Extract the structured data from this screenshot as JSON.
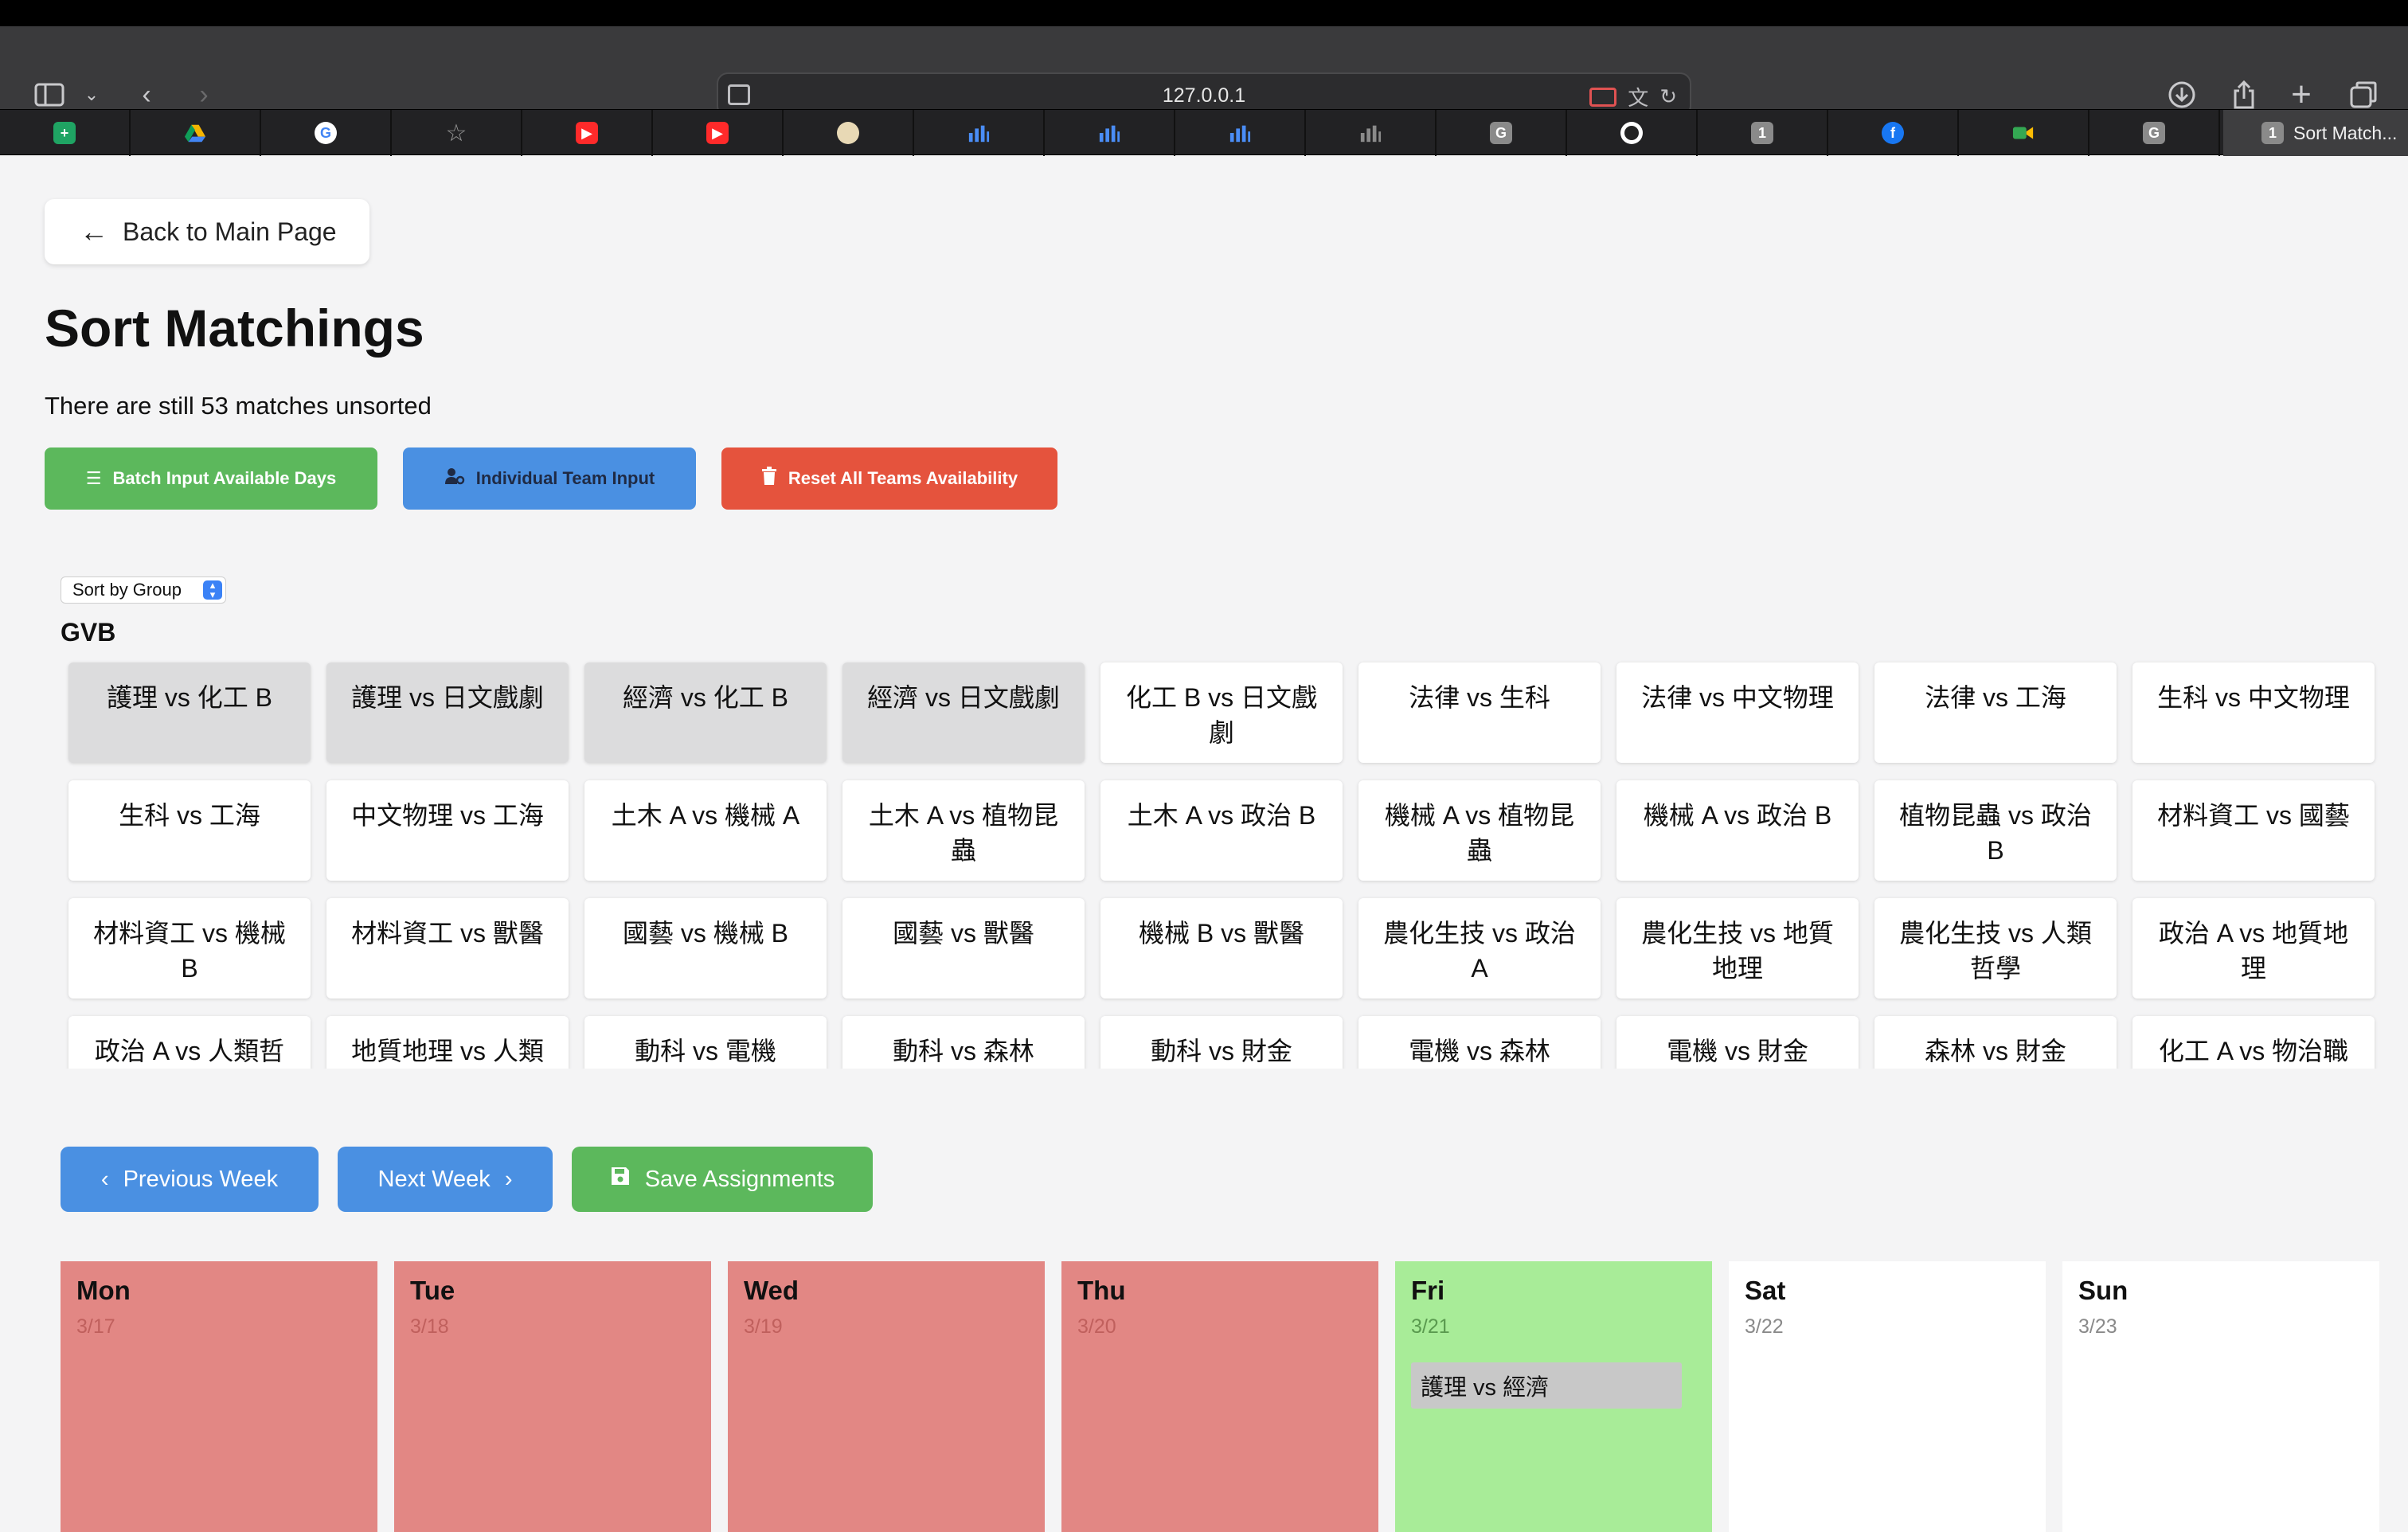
{
  "browser": {
    "url": "127.0.0.1",
    "active_tab_title": "Sort Match...",
    "active_tab_badge": "1",
    "tabs": [
      {
        "icon": "sheets-icon",
        "badge": "",
        "color": "#1fa463"
      },
      {
        "icon": "drive-icon",
        "badge": "",
        "color": "#f4b400"
      },
      {
        "icon": "google-icon",
        "badge": "G",
        "color": "#ffffff"
      },
      {
        "icon": "star-icon",
        "badge": "☆",
        "color": "#9a9a9a"
      },
      {
        "icon": "youtube-icon",
        "badge": "▶",
        "color": "#ff2a2a"
      },
      {
        "icon": "youtube-icon",
        "badge": "▶",
        "color": "#ff2a2a"
      },
      {
        "icon": "seal-icon",
        "badge": "",
        "color": "#e8d9b5"
      },
      {
        "icon": "analytics-icon",
        "badge": "",
        "color": "#4a8df6"
      },
      {
        "icon": "analytics-icon",
        "badge": "",
        "color": "#4a8df6"
      },
      {
        "icon": "analytics-icon",
        "badge": "",
        "color": "#4a8df6"
      },
      {
        "icon": "analytics-gray-icon",
        "badge": "",
        "color": "#8a8a8a"
      },
      {
        "icon": "letter-g-icon",
        "badge": "G",
        "color": "#8a8a8a"
      },
      {
        "icon": "github-icon",
        "badge": "",
        "color": "#ffffff"
      },
      {
        "icon": "number-one-icon",
        "badge": "1",
        "color": "#8a8a8a"
      },
      {
        "icon": "facebook-icon",
        "badge": "f",
        "color": "#1877f2"
      },
      {
        "icon": "meet-icon",
        "badge": "",
        "color": "#34a853"
      },
      {
        "icon": "letter-g-icon",
        "badge": "G",
        "color": "#8a8a8a"
      }
    ]
  },
  "page": {
    "back_label": "Back to Main Page",
    "title": "Sort Matchings",
    "unsorted_text": "There are still 53 matches unsorted",
    "buttons": {
      "batch": "Batch Input Available Days",
      "individual": "Individual Team Input",
      "reset": "Reset All Teams Availability"
    },
    "sort_select": "Sort by Group",
    "group_name": "GVB",
    "matches": [
      {
        "label": "護理 vs 化工 B",
        "assigned": true
      },
      {
        "label": "護理 vs 日文戲劇",
        "assigned": true
      },
      {
        "label": "經濟 vs 化工 B",
        "assigned": true
      },
      {
        "label": "經濟 vs 日文戲劇",
        "assigned": true
      },
      {
        "label": "化工 B vs 日文戲劇",
        "assigned": false
      },
      {
        "label": "法律 vs 生科",
        "assigned": false
      },
      {
        "label": "法律 vs 中文物理",
        "assigned": false
      },
      {
        "label": "法律 vs 工海",
        "assigned": false
      },
      {
        "label": "生科 vs 中文物理",
        "assigned": false
      },
      {
        "label": "生科 vs 工海",
        "assigned": false
      },
      {
        "label": "中文物理 vs 工海",
        "assigned": false
      },
      {
        "label": "土木 A vs 機械 A",
        "assigned": false
      },
      {
        "label": "土木 A vs 植物昆蟲",
        "assigned": false
      },
      {
        "label": "土木 A vs 政治 B",
        "assigned": false
      },
      {
        "label": "機械 A vs 植物昆蟲",
        "assigned": false
      },
      {
        "label": "機械 A vs 政治 B",
        "assigned": false
      },
      {
        "label": "植物昆蟲 vs 政治 B",
        "assigned": false
      },
      {
        "label": "材料資工 vs 國藝",
        "assigned": false
      },
      {
        "label": "材料資工 vs 機械 B",
        "assigned": false
      },
      {
        "label": "材料資工 vs 獸醫",
        "assigned": false
      },
      {
        "label": "國藝 vs 機械 B",
        "assigned": false
      },
      {
        "label": "國藝 vs 獸醫",
        "assigned": false
      },
      {
        "label": "機械 B vs 獸醫",
        "assigned": false
      },
      {
        "label": "農化生技 vs 政治 A",
        "assigned": false
      },
      {
        "label": "農化生技 vs 地質地理",
        "assigned": false
      },
      {
        "label": "農化生技 vs 人類哲學",
        "assigned": false
      },
      {
        "label": "政治 A vs 地質地理",
        "assigned": false
      },
      {
        "label": "政治 A vs 人類哲",
        "assigned": false
      },
      {
        "label": "地質地理 vs 人類",
        "assigned": false
      },
      {
        "label": "動科 vs 電機",
        "assigned": false
      },
      {
        "label": "動科 vs 森林",
        "assigned": false
      },
      {
        "label": "動科 vs 財金",
        "assigned": false
      },
      {
        "label": "電機 vs 森林",
        "assigned": false
      },
      {
        "label": "電機 vs 財金",
        "assigned": false
      },
      {
        "label": "森林 vs 財金",
        "assigned": false
      },
      {
        "label": "化工 A vs 物治職",
        "assigned": false
      }
    ],
    "nav": {
      "prev": "Previous Week",
      "next": "Next Week",
      "save": "Save Assignments"
    },
    "week": [
      {
        "name": "Mon",
        "date": "3/17",
        "status": "unavailable",
        "matches": []
      },
      {
        "name": "Tue",
        "date": "3/18",
        "status": "unavailable",
        "matches": []
      },
      {
        "name": "Wed",
        "date": "3/19",
        "status": "unavailable",
        "matches": []
      },
      {
        "name": "Thu",
        "date": "3/20",
        "status": "unavailable",
        "matches": []
      },
      {
        "name": "Fri",
        "date": "3/21",
        "status": "available",
        "matches": [
          "護理 vs 經濟"
        ]
      },
      {
        "name": "Sat",
        "date": "3/22",
        "status": "open",
        "matches": []
      },
      {
        "name": "Sun",
        "date": "3/23",
        "status": "open",
        "matches": []
      }
    ]
  }
}
